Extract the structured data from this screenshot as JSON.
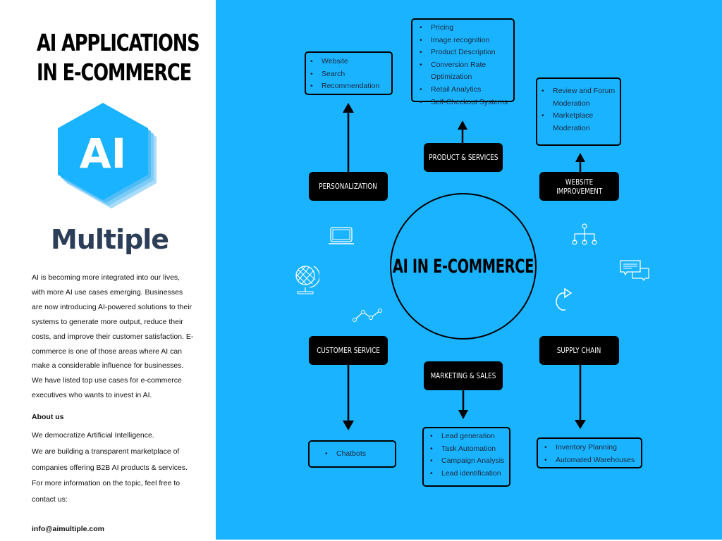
{
  "sidebar": {
    "title_line1": "AI APPLICATIONS",
    "title_line2": "IN E-COMMERCE",
    "logo_text": "AI",
    "brand": "Multiple",
    "description": "AI is becoming more integrated into our lives, with more AI use cases emerging. Businesses are now introducing AI-powered solutions to their systems to generate more output, reduce their costs, and improve their customer satisfaction. E-commerce is one of those areas where AI can make a considerable influence for businesses. We have listed top use cases for e-commerce executives who wants to invest in AI.",
    "about_heading": "About us",
    "about_lines": [
      "We democratize Artificial Intelligence.",
      "We are building a transparent marketplace of companies offering B2B AI products & services.",
      "For more information on the topic, feel free to contact us:"
    ],
    "email": "info@aimultiple.com"
  },
  "diagram": {
    "center": "AI IN E-COMMERCE",
    "colors": {
      "panel": "#1ab3ff",
      "node": "#000000",
      "logo": "#1ab3ff",
      "brand": "#2c3e57"
    },
    "categories": [
      {
        "id": "personalization",
        "label": "PERSONALIZATION",
        "items": [
          "Website",
          "Search",
          "Recommendation"
        ]
      },
      {
        "id": "product-services",
        "label": "PRODUCT & SERVICES",
        "items": [
          "Pricing",
          "Image recognition",
          "Product Description",
          "Conversion Rate Optimization",
          "Retail Analytics",
          "Self-Checkout Systems"
        ]
      },
      {
        "id": "website-improvement",
        "label": "WEBSITE IMPROVEMENT",
        "label_line1": "WEBSITE",
        "label_line2": "IMPROVEMENT",
        "items": [
          "Review and Forum Moderation",
          "Marketplace Moderation"
        ]
      },
      {
        "id": "customer-service",
        "label": "CUSTOMER SERVICE",
        "items": [
          "Chatbots"
        ]
      },
      {
        "id": "marketing-sales",
        "label": "MARKETING & SALES",
        "items": [
          "Lead generation",
          "Task Automation",
          "Campaign Analysis",
          "Lead identification"
        ]
      },
      {
        "id": "supply-chain",
        "label": "SUPPLY CHAIN",
        "items": [
          "Inventory Planning",
          "Automated Warehouses"
        ]
      }
    ],
    "decor_icons": [
      "laptop-icon",
      "globe-icon",
      "line-chart-icon",
      "hierarchy-icon",
      "chat-bubbles-icon",
      "redo-arrow-icon"
    ]
  }
}
